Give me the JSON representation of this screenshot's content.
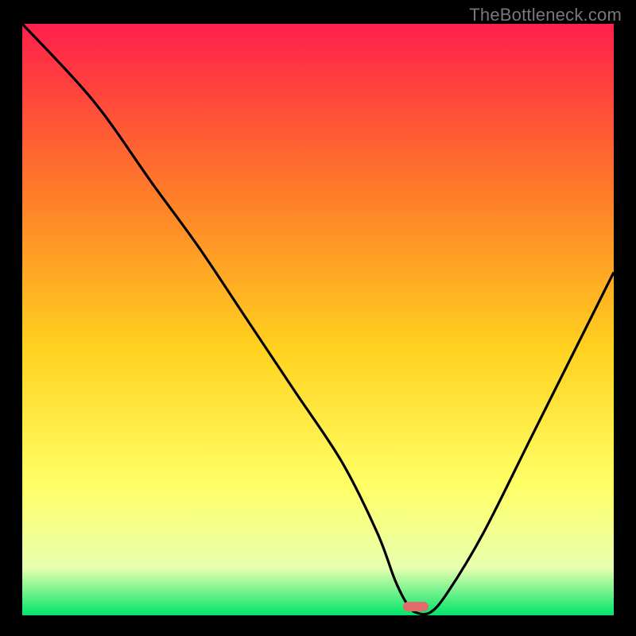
{
  "watermark": "TheBottleneck.com",
  "colors": {
    "background": "#000000",
    "gradient_top": "#ff1f4b",
    "gradient_upper_mid": "#ff7a2a",
    "gradient_mid": "#ffd21f",
    "gradient_lower_mid": "#ffff66",
    "gradient_near_bottom": "#e8ffb0",
    "gradient_bottom": "#00e56b",
    "curve_stroke": "#000000",
    "marker_fill": "#e36a6a"
  },
  "marker": {
    "x_frac": 0.665,
    "y_frac": 0.985
  },
  "chart_data": {
    "type": "line",
    "title": "",
    "xlabel": "",
    "ylabel": "",
    "xlim": [
      0,
      100
    ],
    "ylim": [
      0,
      100
    ],
    "series": [
      {
        "name": "bottleneck-curve",
        "x": [
          0,
          12,
          22,
          30,
          38,
          46,
          54,
          60,
          63,
          65,
          66.5,
          69,
          72,
          78,
          86,
          94,
          100
        ],
        "values": [
          100,
          87,
          73,
          62,
          50,
          38,
          26,
          14,
          6,
          2,
          0.5,
          0.5,
          4,
          14,
          30,
          46,
          58
        ]
      }
    ],
    "annotations": [
      {
        "type": "marker",
        "x": 66.5,
        "y": 1.5,
        "label": "optimal-point"
      }
    ]
  }
}
